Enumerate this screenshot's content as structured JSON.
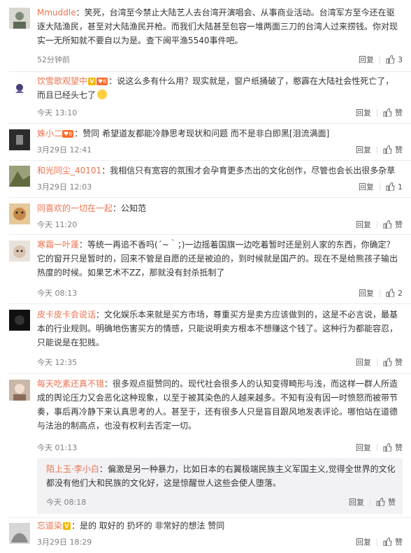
{
  "actions": {
    "reply": "回复",
    "like": "赞"
  },
  "comments": [
    {
      "name": "Mmuddle",
      "sep": "：",
      "text": "笑死，台湾至今禁止大陆艺人去台湾开演唱会、从事商业活动。台湾军方至今还在驱逐大陆渔民，甚至对大陆渔民开枪。而我们大陆甚至包容一堆两面三刀的台湾人过来捞钱。你对现实一无所知就不要自以为是。查下闽平渔5540事件吧。",
      "time": "52分钟前",
      "likes": "3"
    },
    {
      "name": "饮雪歌观望中",
      "sep": "：",
      "text": "说这么多有什么用？现实就是，窗户纸捅破了，憨霹在大陆社会性死亡了，而且已经头七了",
      "time": "今天 13:10",
      "likes": "赞"
    },
    {
      "name": "姝小二",
      "sep": "：",
      "text": "赞同 希望道友都能冷静思考现状和问题 而不是非白即黑[泪流满面]",
      "time": "3月29日 12:41",
      "likes": "赞"
    },
    {
      "name": "和光同尘_40101",
      "sep": "：",
      "text": "我相信只有宽容的氛围才会孕育更多杰出的文化创作，尽管也会长出很多杂草",
      "time": "3月29日 12:03",
      "likes": "1"
    },
    {
      "name": "同喜欢的一切在一起",
      "sep": "：",
      "text": "公知范",
      "time": "今天 11:20",
      "likes": "赞"
    },
    {
      "name": "寒霜一叶蓬",
      "sep": "：",
      "text": "等统一再追不香吗(´~｀；)一边摇着国旗一边吃着暂时还是别人家的东西，你确定？它的窗开只是暂时的，回来不管是自愿的还是被迫的，到时候就是国产的。现在不是给熊孩子输出热度的时候。如果艺术不ZZ，那就没有封杀抵制了",
      "time": "今天 08:13",
      "likes": "2"
    },
    {
      "name": "皮卡皮卡会说话",
      "sep": "：",
      "text": "文化娱乐本来就是买方市场，尊重买方是卖方应该做到的，这是不必言说，最基本的行业规则。明确地伤害买方的情感，只能说明卖方根本不想赚这个钱了。这种行为都能容忍，只能说是在犯贱。",
      "time": "今天 12:35",
      "likes": "赞"
    },
    {
      "name": "每天吃素还真不错",
      "sep": "：",
      "text": "很多观点挺赞同的。现代社会很多人的认知变得畸形与浅，而这样一群人所造成的舆论压力又会恶化这种现象，以至于被其染色的人越来越多。不知有没有因一时愤怒而被带节奏，事后再冷静下来认真思考的人。甚至于，还有很多人只是盲目跟风地发表评论。哪怕站在道德与法治的制高点，也没有权利去否定一切。",
      "time": "今天 01:13",
      "likes": "赞"
    },
    {
      "name": "陌上玉·李小白",
      "sep": "：",
      "text": "偏激是另一种暴力，比如日本的右翼极端民族主义军国主义,觉得全世界的文化都没有他们大和民族的文化好，这是惊醒世人这些会使人堕落。",
      "time": "今天 08:18",
      "likes": "赞"
    },
    {
      "name": "忘道染",
      "sep": "：",
      "text": "是的 取好的 扔坏的  非常好的想法 赞同",
      "time": "3月29日 18:29",
      "likes": "赞"
    }
  ]
}
